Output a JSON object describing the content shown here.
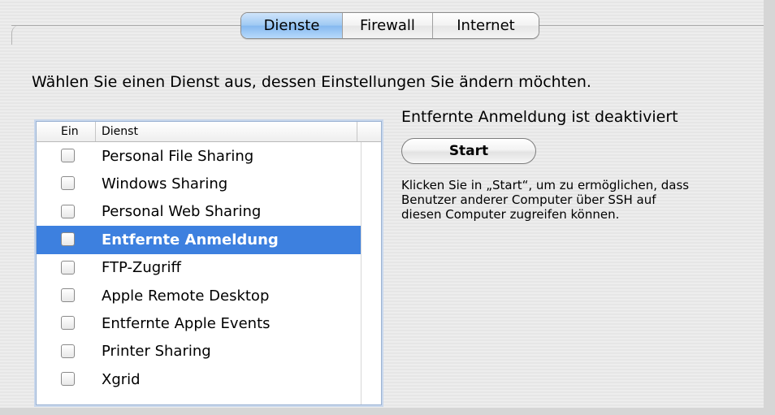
{
  "tabs": [
    {
      "label": "Dienste",
      "active": true
    },
    {
      "label": "Firewall",
      "active": false
    },
    {
      "label": "Internet",
      "active": false
    }
  ],
  "instruction": "Wählen Sie einen Dienst aus, dessen Einstellungen Sie ändern möchten.",
  "table": {
    "headers": {
      "on": "Ein",
      "service": "Dienst"
    },
    "rows": [
      {
        "label": "Personal File Sharing",
        "checked": false,
        "selected": false
      },
      {
        "label": "Windows Sharing",
        "checked": false,
        "selected": false
      },
      {
        "label": "Personal Web Sharing",
        "checked": false,
        "selected": false
      },
      {
        "label": "Entfernte Anmeldung",
        "checked": false,
        "selected": true
      },
      {
        "label": "FTP-Zugriff",
        "checked": false,
        "selected": false
      },
      {
        "label": "Apple Remote Desktop",
        "checked": false,
        "selected": false
      },
      {
        "label": "Entfernte Apple Events",
        "checked": false,
        "selected": false
      },
      {
        "label": "Printer Sharing",
        "checked": false,
        "selected": false
      },
      {
        "label": "Xgrid",
        "checked": false,
        "selected": false
      }
    ]
  },
  "detail": {
    "status": "Entfernte Anmeldung ist deaktiviert",
    "button_label": "Start",
    "help_lines": [
      "Klicken Sie in „Start“, um zu ermöglichen, dass",
      "Benutzer anderer Computer über SSH auf",
      "diesen Computer zugreifen können."
    ]
  },
  "colors": {
    "selection": "#3d80df",
    "active_tab": "#9ec9f3"
  }
}
